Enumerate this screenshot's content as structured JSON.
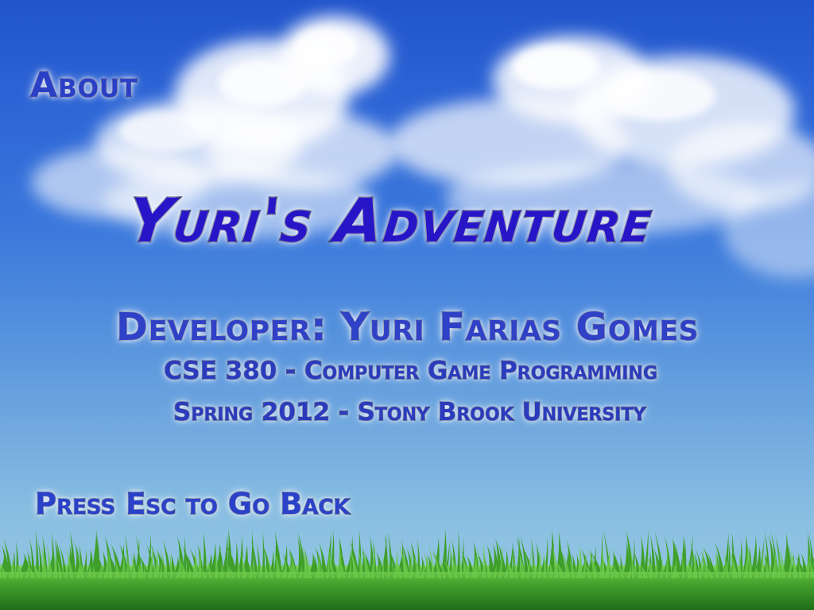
{
  "screen": {
    "title": "About"
  },
  "game": {
    "title": "Yuri's Adventure"
  },
  "credits": {
    "developer": "Developer: Yuri Farias Gomes",
    "course": "CSE 380 - Computer Game Programming",
    "term": "Spring 2012 - Stony Brook University"
  },
  "controls": {
    "back_hint": "Press Esc to Go Back"
  },
  "scene": {
    "background": "sky-with-clouds",
    "ground": "grass",
    "colors": {
      "sky_top": "#2154cc",
      "sky_bottom": "#95c7e0",
      "cloud": "#ffffff",
      "grass": "#3f9f2a",
      "text_fill": "#2a3cbd",
      "title_fill": "#2716c8",
      "text_outline": "#0a0f3c"
    }
  }
}
